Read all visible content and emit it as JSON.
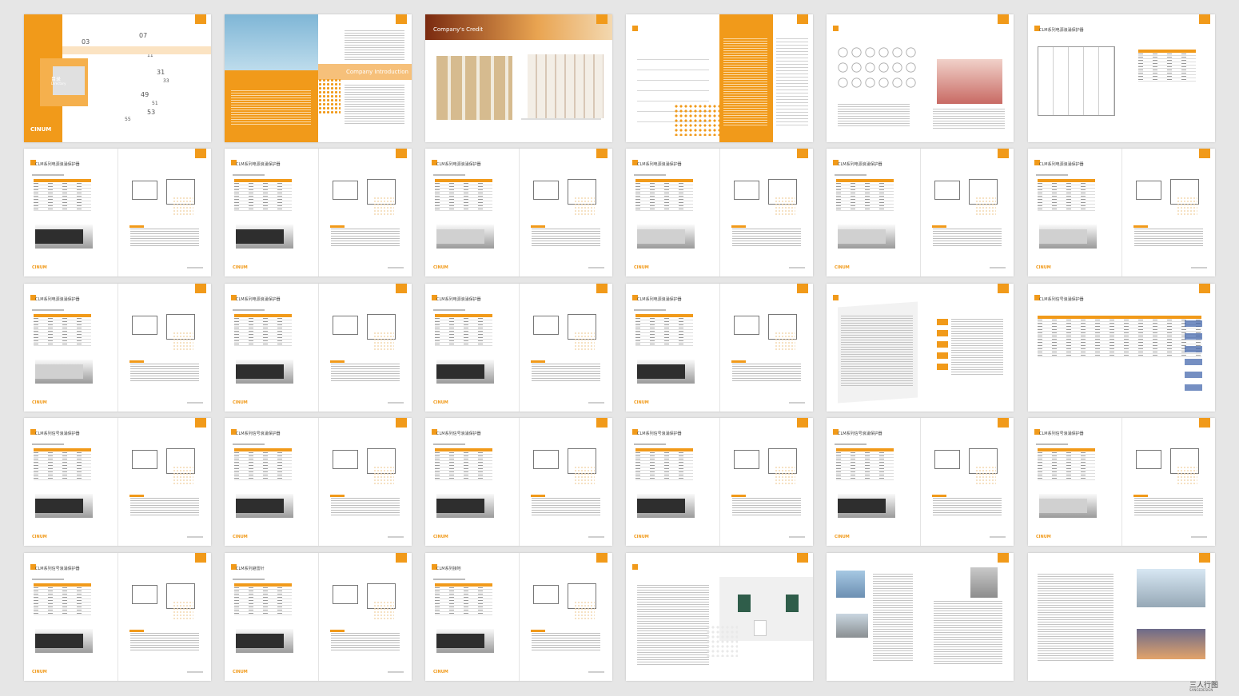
{
  "brand": "CINUM",
  "colors": {
    "accent": "#f19a1a",
    "background": "#e6e6e6",
    "page": "#ffffff"
  },
  "cover": {
    "contents_label": "目录",
    "contents_en": "Directory",
    "numbers": [
      "03",
      "05",
      "07",
      "11",
      "31",
      "33",
      "49",
      "51",
      "53",
      "55"
    ]
  },
  "intro": {
    "title": "Company Introduction"
  },
  "credit": {
    "title": "Company's Credit"
  },
  "product_titles": [
    "CLM系列电源浪涌保护器",
    "CLM系列信号浪涌保护器",
    "CLM系列网络浪涌保护器",
    "CLM系列避雷针",
    "CLM系列接地"
  ],
  "watermark": {
    "cn": "三人行图",
    "en": "SANGEDESIGN"
  }
}
